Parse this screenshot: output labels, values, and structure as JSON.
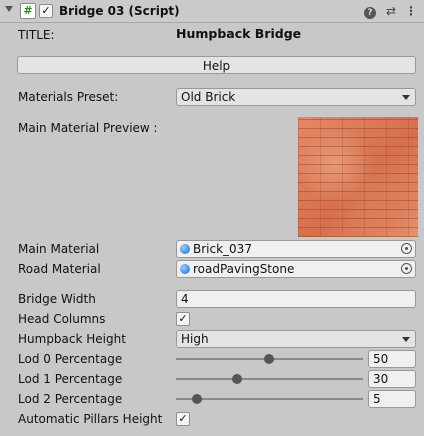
{
  "header": {
    "title": "Bridge 03 (Script)",
    "enabled": true,
    "script_icon_glyph": "#",
    "icons": [
      "foldout-arrow-icon",
      "script-icon",
      "help-icon",
      "preset-icon",
      "kebab-menu-icon"
    ]
  },
  "title_row": {
    "label": "TITLE:",
    "value": "Humpback Bridge"
  },
  "help_button": {
    "label": "Help"
  },
  "materials_preset": {
    "label": "Materials Preset:",
    "value": "Old Brick"
  },
  "preview": {
    "label": "Main Material Preview :"
  },
  "main_material": {
    "label": "Main Material",
    "value": "Brick_037"
  },
  "road_material": {
    "label": "Road Material",
    "value": "roadPavingStone"
  },
  "bridge_width": {
    "label": "Bridge Width",
    "value": "4"
  },
  "head_columns": {
    "label": "Head Columns",
    "checked": true
  },
  "humpback_height": {
    "label": "Humpback Height",
    "value": "High"
  },
  "lod0": {
    "label": "Lod 0 Percentage",
    "value": "50",
    "fraction": 0.5
  },
  "lod1": {
    "label": "Lod 1 Percentage",
    "value": "30",
    "fraction": 0.3
  },
  "lod2": {
    "label": "Lod 2 Percentage",
    "value": "5",
    "fraction": 0.05
  },
  "auto_pillars": {
    "label": "Automatic Pillars Height",
    "checked": true
  },
  "colors": {
    "background": "#c8c8c8",
    "object_icon": "#1c6cc8",
    "brick": "#d97d58"
  }
}
